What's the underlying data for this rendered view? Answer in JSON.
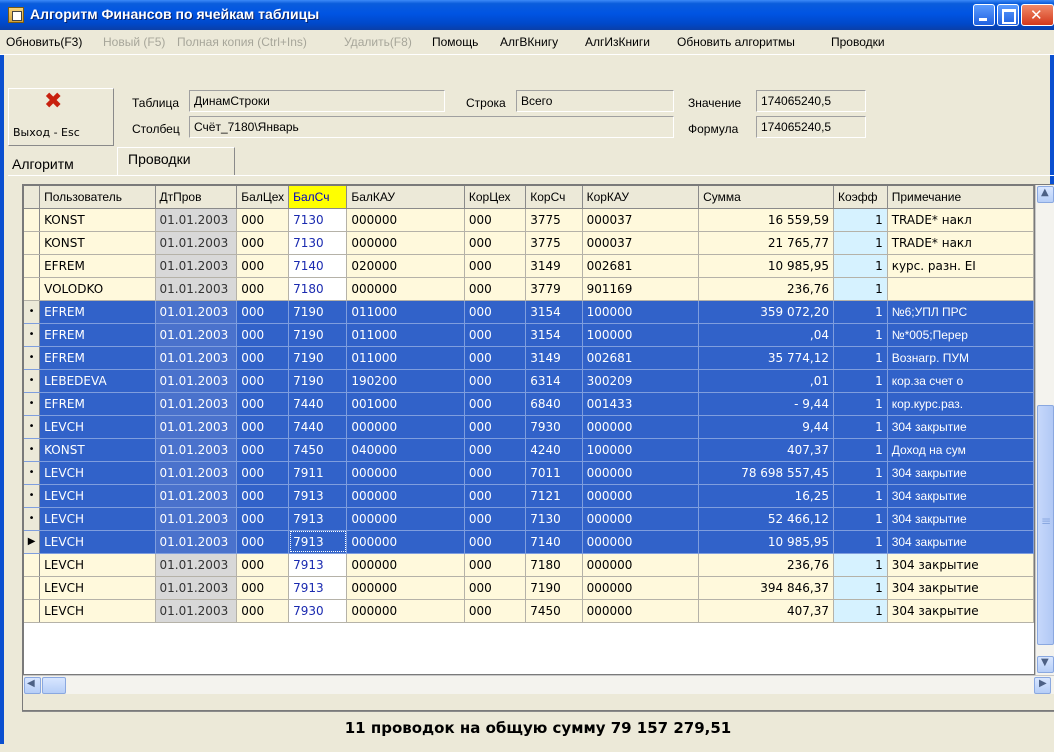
{
  "window": {
    "title": "Алгоритм Финансов по ячейкам таблицы"
  },
  "menu": [
    {
      "label": "Обновить(F3)",
      "enabled": true
    },
    {
      "label": "Новый (F5)",
      "enabled": false
    },
    {
      "label": "Полная копия (Ctrl+Ins)",
      "enabled": false
    },
    {
      "label": "Удалить(F8)",
      "enabled": false
    },
    {
      "label": "Помощь",
      "enabled": true
    },
    {
      "label": "АлгВКнигу",
      "enabled": true
    },
    {
      "label": "АлгИзКниги",
      "enabled": true
    },
    {
      "label": "Обновить алгоритмы",
      "enabled": true
    },
    {
      "label": "Проводки",
      "enabled": true
    }
  ],
  "header": {
    "exit_label": "Выход - Esc",
    "table_label": "Таблица",
    "table_value": "ДинамСтроки",
    "column_label": "Столбец",
    "column_value": "Счёт_7180\\Январь",
    "row_label": "Строка",
    "row_value": "Всего",
    "value_label": "Значение",
    "value_value": "174065240,5",
    "formula_label": "Формула",
    "formula_value": "174065240,5"
  },
  "tabs": [
    {
      "label": "Алгоритм",
      "active": false
    },
    {
      "label": "Проводки",
      "active": true
    }
  ],
  "grid": {
    "columns": [
      "Пользователь",
      "ДтПров",
      "БалЦех",
      "БалСч",
      "БалКАУ",
      "КорЦех",
      "КорСч",
      "КорКАУ",
      "Сумма",
      "Коэфф",
      "Примечание"
    ],
    "rows": [
      {
        "user": "KONST",
        "date": "01.01.2003",
        "balceh": "000",
        "balsch": "7130",
        "balkau": "000000",
        "korceh": "000",
        "korsch": "3775",
        "korkau": "000037",
        "sum": "16 559,59",
        "koef": "1",
        "note": "TRADE* накл",
        "selected": false,
        "marker": ""
      },
      {
        "user": "KONST",
        "date": "01.01.2003",
        "balceh": "000",
        "balsch": "7130",
        "balkau": "000000",
        "korceh": "000",
        "korsch": "3775",
        "korkau": "000037",
        "sum": "21 765,77",
        "koef": "1",
        "note": "TRADE* накл",
        "selected": false,
        "marker": ""
      },
      {
        "user": "EFREM",
        "date": "01.01.2003",
        "balceh": "000",
        "balsch": "7140",
        "balkau": "020000",
        "korceh": "000",
        "korsch": "3149",
        "korkau": "002681",
        "sum": "10 985,95",
        "koef": "1",
        "note": "курс. разн. EI",
        "selected": false,
        "marker": ""
      },
      {
        "user": "VOLODKO",
        "date": "01.01.2003",
        "balceh": "000",
        "balsch": "7180",
        "balkau": "000000",
        "korceh": "000",
        "korsch": "3779",
        "korkau": "901169",
        "sum": "236,76",
        "koef": "1",
        "note": "",
        "selected": false,
        "marker": ""
      },
      {
        "user": "EFREM",
        "date": "01.01.2003",
        "balceh": "000",
        "balsch": "7190",
        "balkau": "011000",
        "korceh": "000",
        "korsch": "3154",
        "korkau": "100000",
        "sum": "359 072,20",
        "koef": "1",
        "note": "№6;УПЛ ПРС",
        "selected": true,
        "marker": "•"
      },
      {
        "user": "EFREM",
        "date": "01.01.2003",
        "balceh": "000",
        "balsch": "7190",
        "balkau": "011000",
        "korceh": "000",
        "korsch": "3154",
        "korkau": "100000",
        "sum": ",04",
        "koef": "1",
        "note": "№*005;Перер",
        "selected": true,
        "marker": "•"
      },
      {
        "user": "EFREM",
        "date": "01.01.2003",
        "balceh": "000",
        "balsch": "7190",
        "balkau": "011000",
        "korceh": "000",
        "korsch": "3149",
        "korkau": "002681",
        "sum": "35 774,12",
        "koef": "1",
        "note": "Вознагр. ПУМ",
        "selected": true,
        "marker": "•"
      },
      {
        "user": "LEBEDEVA",
        "date": "01.01.2003",
        "balceh": "000",
        "balsch": "7190",
        "balkau": "190200",
        "korceh": "000",
        "korsch": "6314",
        "korkau": "300209",
        "sum": ",01",
        "koef": "1",
        "note": "кор.за счет о",
        "selected": true,
        "marker": "•"
      },
      {
        "user": "EFREM",
        "date": "01.01.2003",
        "balceh": "000",
        "balsch": "7440",
        "balkau": "001000",
        "korceh": "000",
        "korsch": "6840",
        "korkau": "001433",
        "sum": "- 9,44",
        "koef": "1",
        "note": "кор.курс.раз.",
        "selected": true,
        "marker": "•"
      },
      {
        "user": "LEVCH",
        "date": "01.01.2003",
        "balceh": "000",
        "balsch": "7440",
        "balkau": "000000",
        "korceh": "000",
        "korsch": "7930",
        "korkau": "000000",
        "sum": "9,44",
        "koef": "1",
        "note": "304 закрытие",
        "selected": true,
        "marker": "•"
      },
      {
        "user": "KONST",
        "date": "01.01.2003",
        "balceh": "000",
        "balsch": "7450",
        "balkau": "040000",
        "korceh": "000",
        "korsch": "4240",
        "korkau": "100000",
        "sum": "407,37",
        "koef": "1",
        "note": "Доход на сум",
        "selected": true,
        "marker": "•"
      },
      {
        "user": "LEVCH",
        "date": "01.01.2003",
        "balceh": "000",
        "balsch": "7911",
        "balkau": "000000",
        "korceh": "000",
        "korsch": "7011",
        "korkau": "000000",
        "sum": "78 698 557,45",
        "koef": "1",
        "note": "304 закрытие",
        "selected": true,
        "marker": "•"
      },
      {
        "user": "LEVCH",
        "date": "01.01.2003",
        "balceh": "000",
        "balsch": "7913",
        "balkau": "000000",
        "korceh": "000",
        "korsch": "7121",
        "korkau": "000000",
        "sum": "16,25",
        "koef": "1",
        "note": "304 закрытие",
        "selected": true,
        "marker": "•"
      },
      {
        "user": "LEVCH",
        "date": "01.01.2003",
        "balceh": "000",
        "balsch": "7913",
        "balkau": "000000",
        "korceh": "000",
        "korsch": "7130",
        "korkau": "000000",
        "sum": "52 466,12",
        "koef": "1",
        "note": "304 закрытие",
        "selected": true,
        "marker": "•"
      },
      {
        "user": "LEVCH",
        "date": "01.01.2003",
        "balceh": "000",
        "balsch": "7913",
        "balkau": "000000",
        "korceh": "000",
        "korsch": "7140",
        "korkau": "000000",
        "sum": "10 985,95",
        "koef": "1",
        "note": "304 закрытие",
        "selected": true,
        "marker": "▶",
        "focus": true
      },
      {
        "user": "LEVCH",
        "date": "01.01.2003",
        "balceh": "000",
        "balsch": "7913",
        "balkau": "000000",
        "korceh": "000",
        "korsch": "7180",
        "korkau": "000000",
        "sum": "236,76",
        "koef": "1",
        "note": "304 закрытие",
        "selected": false,
        "marker": ""
      },
      {
        "user": "LEVCH",
        "date": "01.01.2003",
        "balceh": "000",
        "balsch": "7913",
        "balkau": "000000",
        "korceh": "000",
        "korsch": "7190",
        "korkau": "000000",
        "sum": "394 846,37",
        "koef": "1",
        "note": "304 закрытие",
        "selected": false,
        "marker": ""
      },
      {
        "user": "LEVCH",
        "date": "01.01.2003",
        "balceh": "000",
        "balsch": "7930",
        "balkau": "000000",
        "korceh": "000",
        "korsch": "7450",
        "korkau": "000000",
        "sum": "407,37",
        "koef": "1",
        "note": "304 закрытие",
        "selected": false,
        "marker": ""
      }
    ]
  },
  "footer": {
    "summary": "11 проводок на общую сумму 79 157 279,51"
  },
  "colors": {
    "selection": "#3162c9",
    "highlight_header": "#ffff00",
    "row_bg": "#fff9dc",
    "koef_bg": "#d6f2ff",
    "exit_icon": "#c8200e"
  },
  "icons": {
    "exit": "close-x-icon",
    "app": "table-app-icon"
  }
}
